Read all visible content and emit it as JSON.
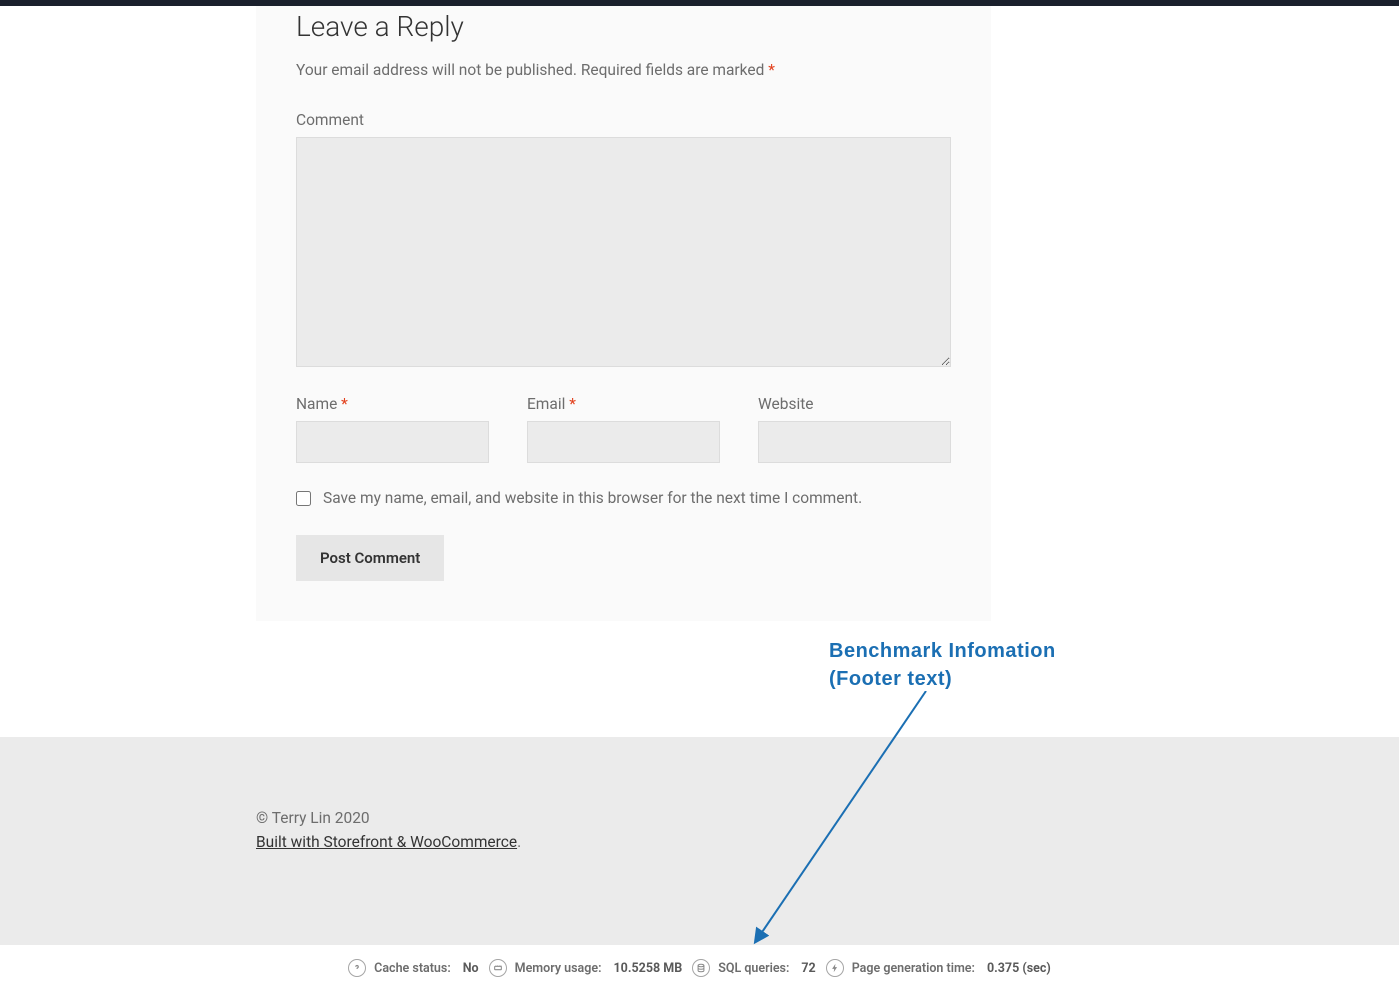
{
  "reply": {
    "title": "Leave a Reply",
    "notes_prefix": "Your email address will not be published.",
    "notes_required": "Required fields are marked",
    "asterisk": "*",
    "comment_label": "Comment",
    "name_label": "Name",
    "email_label": "Email",
    "website_label": "Website",
    "consent_label": "Save my name, email, and website in this browser for the next time I comment.",
    "submit_label": "Post Comment"
  },
  "annotation": {
    "line1": "Benchmark Infomation",
    "line2": "(Footer text)"
  },
  "footer": {
    "copyright": "© Terry Lin 2020",
    "built_with": "Built with Storefront & WooCommerce",
    "period": "."
  },
  "debug": {
    "cache_label": "Cache status:",
    "cache_value": "No",
    "memory_label": "Memory usage:",
    "memory_value": "10.5258 MB",
    "sql_label": "SQL queries:",
    "sql_value": "72",
    "pagegen_label": "Page generation time:",
    "pagegen_value": "0.375 (sec)"
  }
}
